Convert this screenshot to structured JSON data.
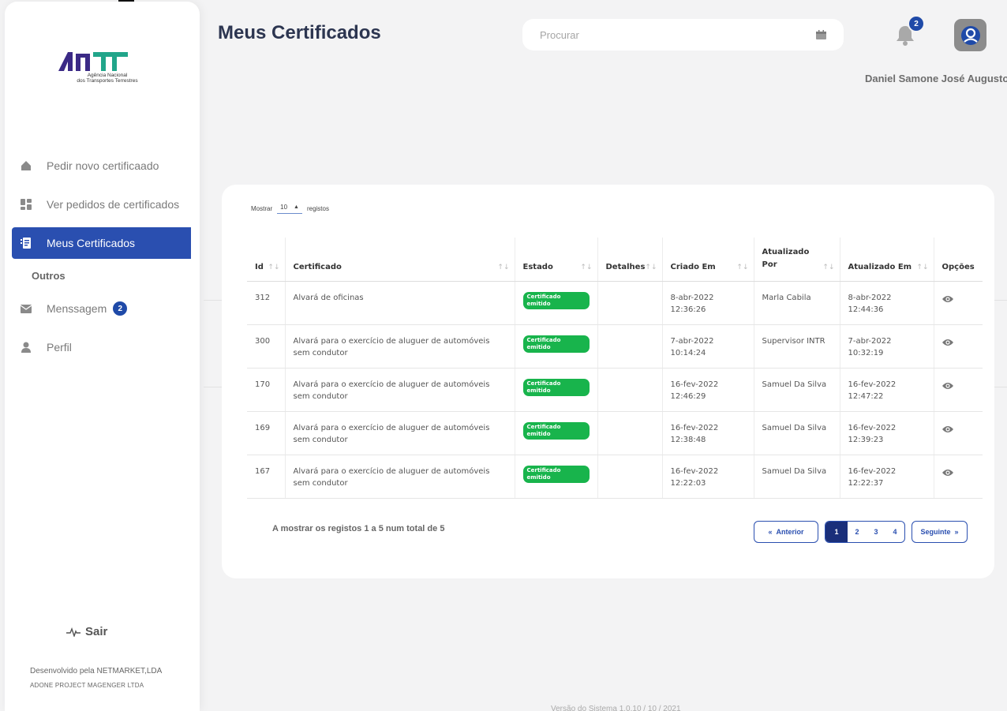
{
  "app": {
    "logo_sub_1": "Agência Nacional",
    "logo_sub_2": "dos Transportes Terrestres",
    "brand_colors": {
      "primary": "#2a4fb0",
      "logo_purple": "#3b2a86",
      "logo_green": "#21a58a",
      "status_green": "#18b44c"
    }
  },
  "sidebar": {
    "items": [
      {
        "label": "Pedir novo certificaado",
        "icon": "home-icon"
      },
      {
        "label": "Ver pedidos de certificados",
        "icon": "dashboard-icon"
      },
      {
        "label": "Meus Certificados",
        "icon": "certificate-icon",
        "active": true
      }
    ],
    "section_title": "Outros",
    "others": [
      {
        "label": "Menssagem",
        "icon": "mail-icon",
        "badge": "2"
      },
      {
        "label": "Perfil",
        "icon": "user-icon"
      }
    ],
    "logout_label": "Sair",
    "dev_line_1": "Desenvolvido pela NETMARKET,LDA",
    "dev_line_2": "ADONE PROJECT MAGENGER LTDA"
  },
  "header": {
    "title": "Meus Certificados",
    "search_placeholder": "Procurar",
    "notifications_count": "2",
    "user_name": "Daniel Samone José Augusto"
  },
  "table": {
    "show_label": "Mostrar",
    "page_size": "10",
    "records_label": "registos",
    "columns": [
      "Id",
      "Certificado",
      "Estado",
      "Detalhes",
      "Criado Em",
      "Atualizado Por",
      "Atualizado Em",
      "Opções"
    ],
    "rows": [
      {
        "id": "312",
        "cert": "Alvará de oficinas",
        "status": "Certificado emitido",
        "details": "",
        "created_date": "8-abr-2022",
        "created_time": "12:36:26",
        "updated_by": "Marla Cabila",
        "updated_date": "8-abr-2022",
        "updated_time": "12:44:36"
      },
      {
        "id": "300",
        "cert": "Alvará para o exercício de aluguer de automóveis sem condutor",
        "status": "Certificado emitido",
        "details": "",
        "created_date": "7-abr-2022",
        "created_time": "10:14:24",
        "updated_by": "Supervisor INTR",
        "updated_date": "7-abr-2022",
        "updated_time": "10:32:19"
      },
      {
        "id": "170",
        "cert": "Alvará para o exercício de aluguer de automóveis sem condutor",
        "status": "Certificado emitido",
        "details": "",
        "created_date": "16-fev-2022",
        "created_time": "12:46:29",
        "updated_by": "Samuel Da Silva",
        "updated_date": "16-fev-2022",
        "updated_time": "12:47:22"
      },
      {
        "id": "169",
        "cert": "Alvará para o exercício de aluguer de automóveis sem condutor",
        "status": "Certificado emitido",
        "details": "",
        "created_date": "16-fev-2022",
        "created_time": "12:38:48",
        "updated_by": "Samuel Da Silva",
        "updated_date": "16-fev-2022",
        "updated_time": "12:39:23"
      },
      {
        "id": "167",
        "cert": "Alvará para o exercício de aluguer de automóveis sem condutor",
        "status": "Certificado emitido",
        "details": "",
        "created_date": "16-fev-2022",
        "created_time": "12:22:03",
        "updated_by": "Samuel Da Silva",
        "updated_date": "16-fev-2022",
        "updated_time": "12:22:37"
      }
    ],
    "summary": "A mostrar os registos 1 a 5 num total de 5",
    "pagination": {
      "prev_label": "Anterior",
      "next_label": "Seguinte",
      "pages": [
        "1",
        "2",
        "3",
        "4"
      ],
      "current": "1"
    }
  },
  "footer": {
    "version": "Versão do Sistema 1.0.10 / 10 / 2021"
  }
}
